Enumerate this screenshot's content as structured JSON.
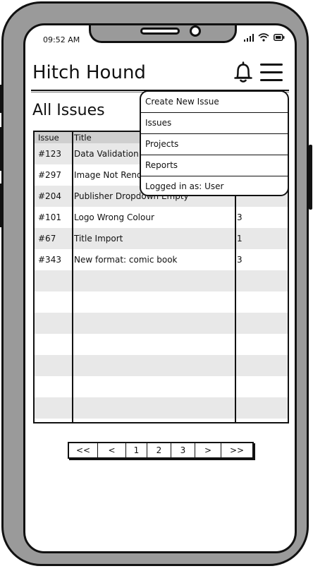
{
  "status_bar": {
    "time": "09:52 AM"
  },
  "header": {
    "app_title": "Hitch Hound"
  },
  "page": {
    "title": "All Issues"
  },
  "table": {
    "columns": {
      "issue": "Issue",
      "title": "Title",
      "priority": ""
    },
    "rows": [
      {
        "issue": "#123",
        "title": "Data Validation",
        "priority": ""
      },
      {
        "issue": "#297",
        "title": "Image Not Rendering",
        "priority": ""
      },
      {
        "issue": "#204",
        "title": "Publisher Dropdown Empty",
        "priority": ""
      },
      {
        "issue": "#101",
        "title": "Logo Wrong Colour",
        "priority": "3"
      },
      {
        "issue": "#67",
        "title": "Title Import",
        "priority": "1"
      },
      {
        "issue": "#343",
        "title": "New format: comic book",
        "priority": "3"
      }
    ]
  },
  "pagination": {
    "first": "<<",
    "prev": "<",
    "pages": [
      "1",
      "2",
      "3"
    ],
    "next": ">",
    "last": ">>"
  },
  "menu": {
    "create_new_issue": "Create New Issue",
    "issues": "Issues",
    "projects": "Projects",
    "reports": "Reports",
    "logged_in_as": "Logged in as: User"
  }
}
